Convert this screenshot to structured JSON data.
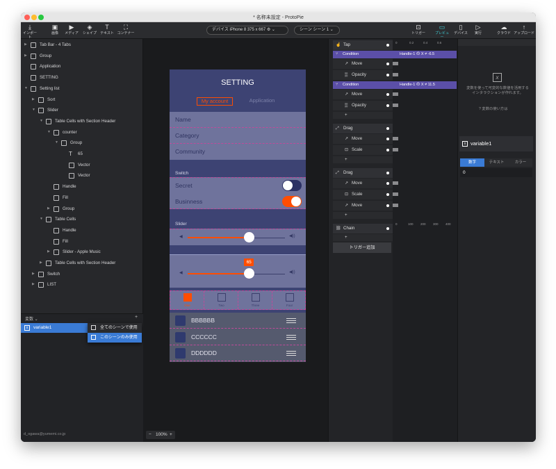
{
  "window": {
    "title": "* 名称未設定 - ProtoPie"
  },
  "toolbar": {
    "import": "インポート",
    "image": "画像",
    "media": "メディア",
    "shape": "シェイプ",
    "text": "テキスト",
    "container": "コンテナー",
    "device": "デバイス iPhone 8 375 x 667 ⚙ ⌄",
    "scene": "シーン シーン 1 ⌄",
    "trigger": "トリガー",
    "preview": "プレビュー",
    "device_btn": "デバイス",
    "run": "実行",
    "cloud": "クラウド",
    "upload": "アップロード"
  },
  "layers": [
    {
      "label": "Tab Bar - 4 Tabs",
      "indent": 0,
      "arrow": "▶",
      "icon": "group"
    },
    {
      "label": "Group",
      "indent": 0,
      "arrow": "▶",
      "icon": "group"
    },
    {
      "label": "Application",
      "indent": 0,
      "arrow": "",
      "icon": "component"
    },
    {
      "label": "SETTING",
      "indent": 0,
      "arrow": "",
      "icon": "component"
    },
    {
      "label": "Setting list",
      "indent": 0,
      "arrow": "▼",
      "icon": "group"
    },
    {
      "label": "Sort",
      "indent": 1,
      "arrow": "▶",
      "icon": "group"
    },
    {
      "label": "Slider",
      "indent": 1,
      "arrow": "▼",
      "icon": "group"
    },
    {
      "label": "Table Cells with Section Header",
      "indent": 2,
      "arrow": "▼",
      "icon": "group"
    },
    {
      "label": "counter",
      "indent": 3,
      "arrow": "▼",
      "icon": "group"
    },
    {
      "label": "Group",
      "indent": 4,
      "arrow": "▼",
      "icon": "group"
    },
    {
      "label": "65",
      "indent": 5,
      "arrow": "",
      "icon": "text"
    },
    {
      "label": "Vector",
      "indent": 5,
      "arrow": "",
      "icon": "image"
    },
    {
      "label": "Vector",
      "indent": 5,
      "arrow": "",
      "icon": "image"
    },
    {
      "label": "Handle",
      "indent": 3,
      "arrow": "",
      "icon": "image"
    },
    {
      "label": "Fill",
      "indent": 3,
      "arrow": "",
      "icon": "image"
    },
    {
      "label": "Group",
      "indent": 3,
      "arrow": "▶",
      "icon": "group"
    },
    {
      "label": "Table Cells",
      "indent": 2,
      "arrow": "▼",
      "icon": "group"
    },
    {
      "label": "Handle",
      "indent": 3,
      "arrow": "",
      "icon": "image"
    },
    {
      "label": "Fill",
      "indent": 3,
      "arrow": "",
      "icon": "image"
    },
    {
      "label": "Slider - Apple Music",
      "indent": 3,
      "arrow": "▶",
      "icon": "group"
    },
    {
      "label": "Table Cells with Section Header",
      "indent": 2,
      "arrow": "▶",
      "icon": "group"
    },
    {
      "label": "Switch",
      "indent": 1,
      "arrow": "▶",
      "icon": "group"
    },
    {
      "label": "LIST",
      "indent": 1,
      "arrow": "▶",
      "icon": "group"
    }
  ],
  "variables": {
    "header": "変数 ⌄",
    "add": "+",
    "item": "variable1",
    "menu_all": "全てのシーンで使用",
    "menu_this": "このシーンのみ使用"
  },
  "footer": {
    "email": "d_ogawa@yumemi.co.jp",
    "zoom": "100%",
    "zoom_minus": "−",
    "zoom_plus": "+"
  },
  "phone": {
    "title": "SETTING",
    "seg_active": "My account",
    "seg_inactive": "Application",
    "rows": [
      "Name",
      "Category",
      "Community"
    ],
    "switch_header": "Switch",
    "switch_rows": [
      {
        "label": "Secret",
        "on": false
      },
      {
        "label": "Businness",
        "on": true
      }
    ],
    "slider_header": "Slider",
    "slider1": 0.63,
    "slider2": 0.63,
    "slider_badge": "65",
    "tabs": [
      "One",
      "Two",
      "Three",
      "Four"
    ],
    "list": [
      "BBBBBB",
      "CCCCCC",
      "DDDDDD"
    ],
    "colors": {
      "accent": "#ff4d00",
      "bg": "#3d4373",
      "cell": "#6f739c"
    }
  },
  "interactions": {
    "timeline_ticks": [
      "0",
      "0.2",
      "0.4",
      "0.6"
    ],
    "timeline_ticks2": [
      "0",
      "100",
      "200",
      "300",
      "400"
    ],
    "triggers": [
      {
        "name": "Tap",
        "items": [
          {
            "type": "condition",
            "label": "Condition",
            "expr": "Handle-1 の X ≠ -6.5"
          },
          {
            "type": "response",
            "label": "Move"
          },
          {
            "type": "response",
            "label": "Opacity"
          },
          {
            "type": "condition",
            "label": "Condition",
            "expr": "Handle-1 の X ≠ 11.5"
          },
          {
            "type": "response",
            "label": "Move"
          },
          {
            "type": "response",
            "label": "Opacity"
          }
        ]
      },
      {
        "name": "Drag",
        "items": [
          {
            "type": "response",
            "label": "Move"
          },
          {
            "type": "response",
            "label": "Scale"
          }
        ]
      },
      {
        "name": "Drag",
        "items": [
          {
            "type": "response",
            "label": "Move"
          },
          {
            "type": "response",
            "label": "Scale"
          },
          {
            "type": "response",
            "label": "Move"
          }
        ]
      },
      {
        "name": "Chain",
        "items": []
      }
    ],
    "add_trigger": "トリガー追加",
    "add": "+"
  },
  "variable_panel": {
    "empty_text": "変数を使って可変的な数値を活用するインタラクションが作れます。",
    "help": "変数の使い方は",
    "name": "variable1",
    "tabs": [
      "数字",
      "テキスト",
      "カラー"
    ],
    "value": "0"
  }
}
